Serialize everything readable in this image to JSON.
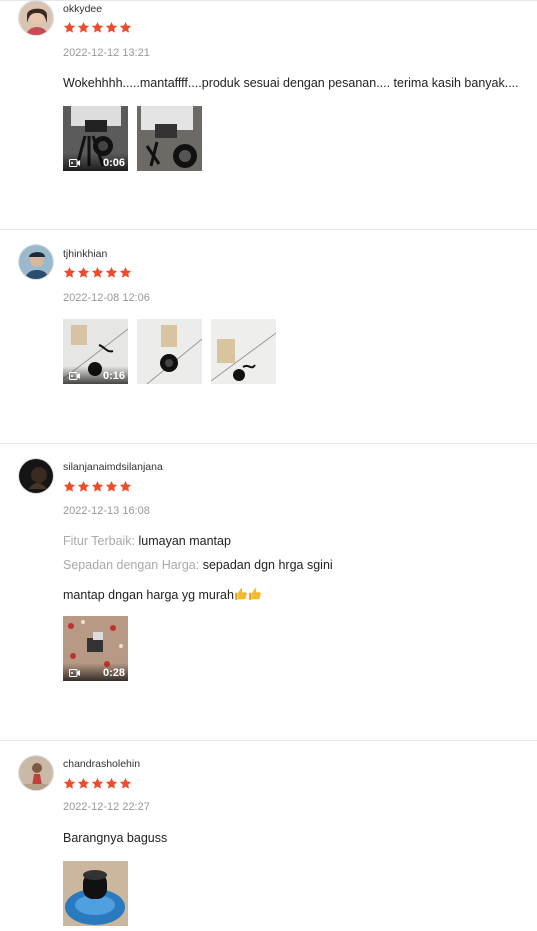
{
  "colors": {
    "star": "#ee4d2d",
    "date": "#999999",
    "label": "#aaaaaa",
    "divider": "#e8e8e8"
  },
  "reviews": [
    {
      "username": "okkydee",
      "rating": 5,
      "date": "2022-12-12 13:21",
      "comment": "Wokehhhh.....mantaffff....produk sesuai dengan pesanan.... terima kasih banyak....",
      "media": [
        {
          "type": "video",
          "duration": "0:06",
          "icon": "video-camera-icon"
        },
        {
          "type": "image"
        }
      ]
    },
    {
      "username": "tjhinkhian",
      "rating": 5,
      "date": "2022-12-08 12:06",
      "media": [
        {
          "type": "video",
          "duration": "0:16",
          "icon": "video-camera-icon"
        },
        {
          "type": "image"
        },
        {
          "type": "image"
        }
      ]
    },
    {
      "username": "silanjanaimdsilanjana",
      "rating": 5,
      "date": "2022-12-13 16:08",
      "attributes": [
        {
          "label": "Fitur Terbaik:",
          "value": "lumayan mantap"
        },
        {
          "label": "Sepadan dengan Harga:",
          "value": "sepadan dgn hrga sgini"
        }
      ],
      "comment": "mantap dngan harga yg murah",
      "comment_emoji": "thumbs-up-icon",
      "media": [
        {
          "type": "video",
          "duration": "0:28",
          "icon": "video-camera-icon"
        }
      ]
    },
    {
      "username": "chandrasholehin",
      "rating": 5,
      "date": "2022-12-12 22:27",
      "comment": "Barangnya baguss",
      "media": [
        {
          "type": "image"
        }
      ]
    }
  ]
}
